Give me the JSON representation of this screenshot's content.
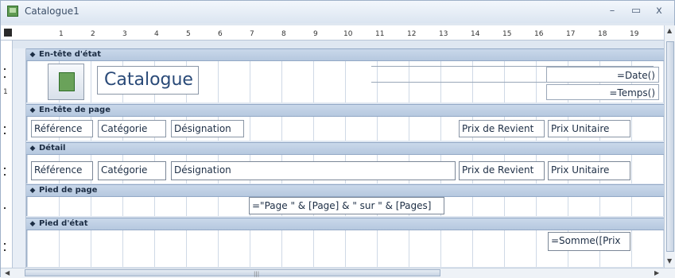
{
  "window": {
    "title": "Catalogue1",
    "minimize": "–",
    "restore": "▭",
    "close": "x"
  },
  "ruler": {
    "numbers": [
      "1",
      "2",
      "3",
      "4",
      "5",
      "6",
      "7",
      "8",
      "9",
      "10",
      "11",
      "12",
      "13",
      "14",
      "15",
      "16",
      "17",
      "18",
      "19"
    ]
  },
  "sections": {
    "report_header": "En-tête d'état",
    "page_header": "En-tête de page",
    "detail": "Détail",
    "page_footer": "Pied de page",
    "report_footer": "Pied d'état"
  },
  "report_header": {
    "title": "Catalogue",
    "date_expr": "=Date()",
    "time_expr": "=Temps()"
  },
  "page_header": {
    "reference": "Référence",
    "category": "Catégorie",
    "designation": "Désignation",
    "cost_price": "Prix de Revient",
    "unit_price": "Prix Unitaire"
  },
  "detail": {
    "reference": "Référence",
    "category": "Catégorie",
    "designation": "Désignation",
    "cost_price": "Prix de Revient",
    "unit_price": "Prix Unitaire"
  },
  "page_footer": {
    "page_expr": "=\"Page \" & [Page] & \" sur \" & [Pages]"
  },
  "report_footer": {
    "sum_expr": "=Somme([Prix"
  },
  "vruler": {
    "n1": "1"
  }
}
